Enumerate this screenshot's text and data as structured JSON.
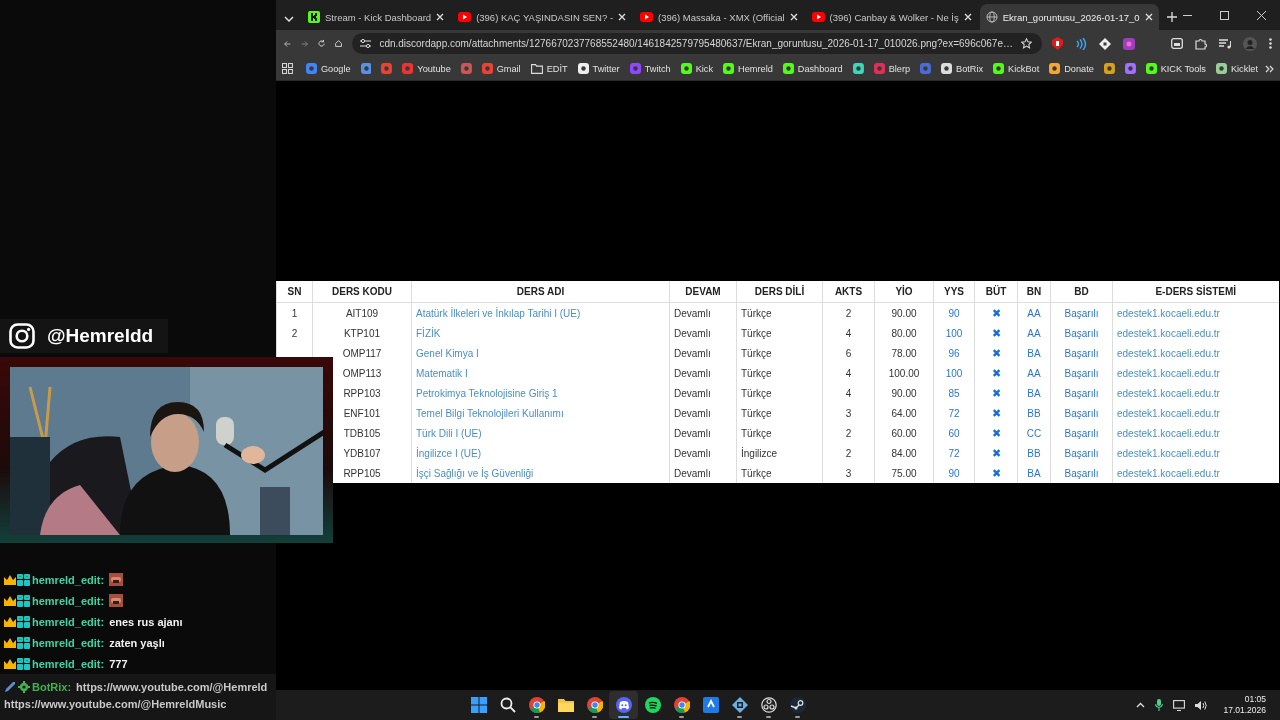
{
  "stream_overlay": {
    "instagram_handle": "@Hemreldd",
    "chat": [
      {
        "user": "hemreld_edit:",
        "kind": "emote"
      },
      {
        "user": "hemreld_edit:",
        "kind": "emote"
      },
      {
        "user": "hemreld_edit:",
        "kind": "text",
        "message": "enes rus ajanı"
      },
      {
        "user": "hemreld_edit:",
        "kind": "text",
        "message": "zaten yaşlı"
      },
      {
        "user": "hemreld_edit:",
        "kind": "text",
        "message": "777"
      }
    ],
    "pinned": {
      "user": "BotRix:",
      "links": [
        "https://www.youtube.com/@Hemreld",
        "https://www.youtube.com/@HemreldMusic"
      ]
    }
  },
  "browser": {
    "tabs": [
      {
        "title": "Stream - Kick Dashboard",
        "kind": "kick",
        "selected": false
      },
      {
        "title": "(396) KAÇ YAŞINDASIN SEN? -",
        "kind": "youtube",
        "selected": false
      },
      {
        "title": "(396) Massaka - XMX (Official",
        "kind": "youtube",
        "selected": false
      },
      {
        "title": "(396) Canbay & Wolker - Ne İş",
        "kind": "youtube",
        "selected": false
      },
      {
        "title": "Ekran_goruntusu_2026-01-17_0",
        "kind": "page",
        "selected": true
      }
    ],
    "address": "cdn.discordapp.com/attachments/1276670237768552480/1461842579795480637/Ekran_goruntusu_2026-01-17_010026.png?ex=696c067e…",
    "bookmarks": [
      {
        "kind": "link",
        "label": "Google"
      },
      {
        "kind": "icon"
      },
      {
        "kind": "icon"
      },
      {
        "kind": "link",
        "label": "Youtube"
      },
      {
        "kind": "icon"
      },
      {
        "kind": "link",
        "label": "Gmail"
      },
      {
        "kind": "folder",
        "label": "EDİT"
      },
      {
        "kind": "link",
        "label": "Twitter"
      },
      {
        "kind": "link",
        "label": "Twitch"
      },
      {
        "kind": "link",
        "label": "Kick"
      },
      {
        "kind": "link",
        "label": "Hemreld"
      },
      {
        "kind": "link",
        "label": "Dashboard"
      },
      {
        "kind": "icon"
      },
      {
        "kind": "link",
        "label": "Blerp"
      },
      {
        "kind": "icon"
      },
      {
        "kind": "link",
        "label": "BotRix"
      },
      {
        "kind": "link",
        "label": "KickBot"
      },
      {
        "kind": "link",
        "label": "Donate"
      },
      {
        "kind": "icon"
      },
      {
        "kind": "icon"
      },
      {
        "kind": "link",
        "label": "KICK Tools"
      },
      {
        "kind": "link",
        "label": "Kicklet"
      }
    ]
  },
  "page": {
    "table": {
      "columns": [
        "SN",
        "DERS KODU",
        "DERS ADI",
        "DEVAM",
        "DERS DİLİ",
        "AKTS",
        "YİO",
        "YYS",
        "BÜT",
        "BN",
        "BD",
        "E-DERS SİSTEMİ"
      ],
      "rows": [
        {
          "sn": "1",
          "code": "AIT109",
          "name": "Atatürk İlkeleri ve İnkılap Tarihi I (UE)",
          "attendance": "Devamlı",
          "language": "Türkçe",
          "akts": "2",
          "yio": "90.00",
          "yys": "90",
          "but": "✖",
          "bn": "AA",
          "bd": "Başarılı",
          "system": "edestek1.kocaeli.edu.tr"
        },
        {
          "sn": "2",
          "code": "KTP101",
          "name": "FİZİK",
          "attendance": "Devamlı",
          "language": "Türkçe",
          "akts": "4",
          "yio": "80.00",
          "yys": "100",
          "but": "✖",
          "bn": "AA",
          "bd": "Başarılı",
          "system": "edestek1.kocaeli.edu.tr"
        },
        {
          "code": "OMP117",
          "name": "Genel Kimya I",
          "attendance": "Devamlı",
          "language": "Türkçe",
          "akts": "6",
          "yio": "78.00",
          "yys": "96",
          "but": "✖",
          "bn": "BA",
          "bd": "Başarılı",
          "system": "edestek1.kocaeli.edu.tr"
        },
        {
          "code": "OMP113",
          "name": "Matematik I",
          "attendance": "Devamlı",
          "language": "Türkçe",
          "akts": "4",
          "yio": "100.00",
          "yys": "100",
          "but": "✖",
          "bn": "AA",
          "bd": "Başarılı",
          "system": "edestek1.kocaeli.edu.tr"
        },
        {
          "code": "RPP103",
          "name": "Petrokimya Teknolojisine Giriş 1",
          "attendance": "Devamlı",
          "language": "Türkçe",
          "akts": "4",
          "yio": "90.00",
          "yys": "85",
          "but": "✖",
          "bn": "BA",
          "bd": "Başarılı",
          "system": "edestek1.kocaeli.edu.tr"
        },
        {
          "code": "ENF101",
          "name": "Temel Bilgi Teknolojileri Kullanımı",
          "attendance": "Devamlı",
          "language": "Türkçe",
          "akts": "3",
          "yio": "64.00",
          "yys": "72",
          "but": "✖",
          "bn": "BB",
          "bd": "Başarılı",
          "system": "edestek1.kocaeli.edu.tr"
        },
        {
          "code": "TDB105",
          "name": "Türk Dili I (UE)",
          "attendance": "Devamlı",
          "language": "Türkçe",
          "akts": "2",
          "yio": "60.00",
          "yys": "60",
          "but": "✖",
          "bn": "CC",
          "bd": "Başarılı",
          "system": "edestek1.kocaeli.edu.tr"
        },
        {
          "code": "YDB107",
          "name": "İngilizce I (UE)",
          "attendance": "Devamlı",
          "language": "İngilizce",
          "akts": "2",
          "yio": "84.00",
          "yys": "72",
          "but": "✖",
          "bn": "BB",
          "bd": "Başarılı",
          "system": "edestek1.kocaeli.edu.tr"
        },
        {
          "code": "RPP105",
          "name": "İşçi Sağlığı ve İş Güvenliği",
          "attendance": "Devamlı",
          "language": "Türkçe",
          "akts": "3",
          "yio": "75.00",
          "yys": "90",
          "but": "✖",
          "bn": "BA",
          "bd": "Başarılı",
          "system": "edestek1.kocaeli.edu.tr"
        }
      ]
    }
  },
  "taskbar": {
    "apps": [
      {
        "kind": "start",
        "active": false,
        "running": false
      },
      {
        "kind": "search",
        "active": false,
        "running": false
      },
      {
        "kind": "chrome",
        "active": false,
        "running": true
      },
      {
        "kind": "folder",
        "active": false,
        "running": false
      },
      {
        "kind": "chrome",
        "active": false,
        "running": true
      },
      {
        "kind": "discord",
        "active": true,
        "running": true
      },
      {
        "kind": "spotify",
        "active": false,
        "running": false
      },
      {
        "kind": "chrome",
        "active": false,
        "running": true
      },
      {
        "kind": "bluebox",
        "active": false,
        "running": false
      },
      {
        "kind": "grid",
        "active": false,
        "running": true
      },
      {
        "kind": "obs",
        "active": false,
        "running": true
      },
      {
        "kind": "steam",
        "active": false,
        "running": true
      }
    ],
    "time": "01:05",
    "date": "17.01.2026"
  }
}
